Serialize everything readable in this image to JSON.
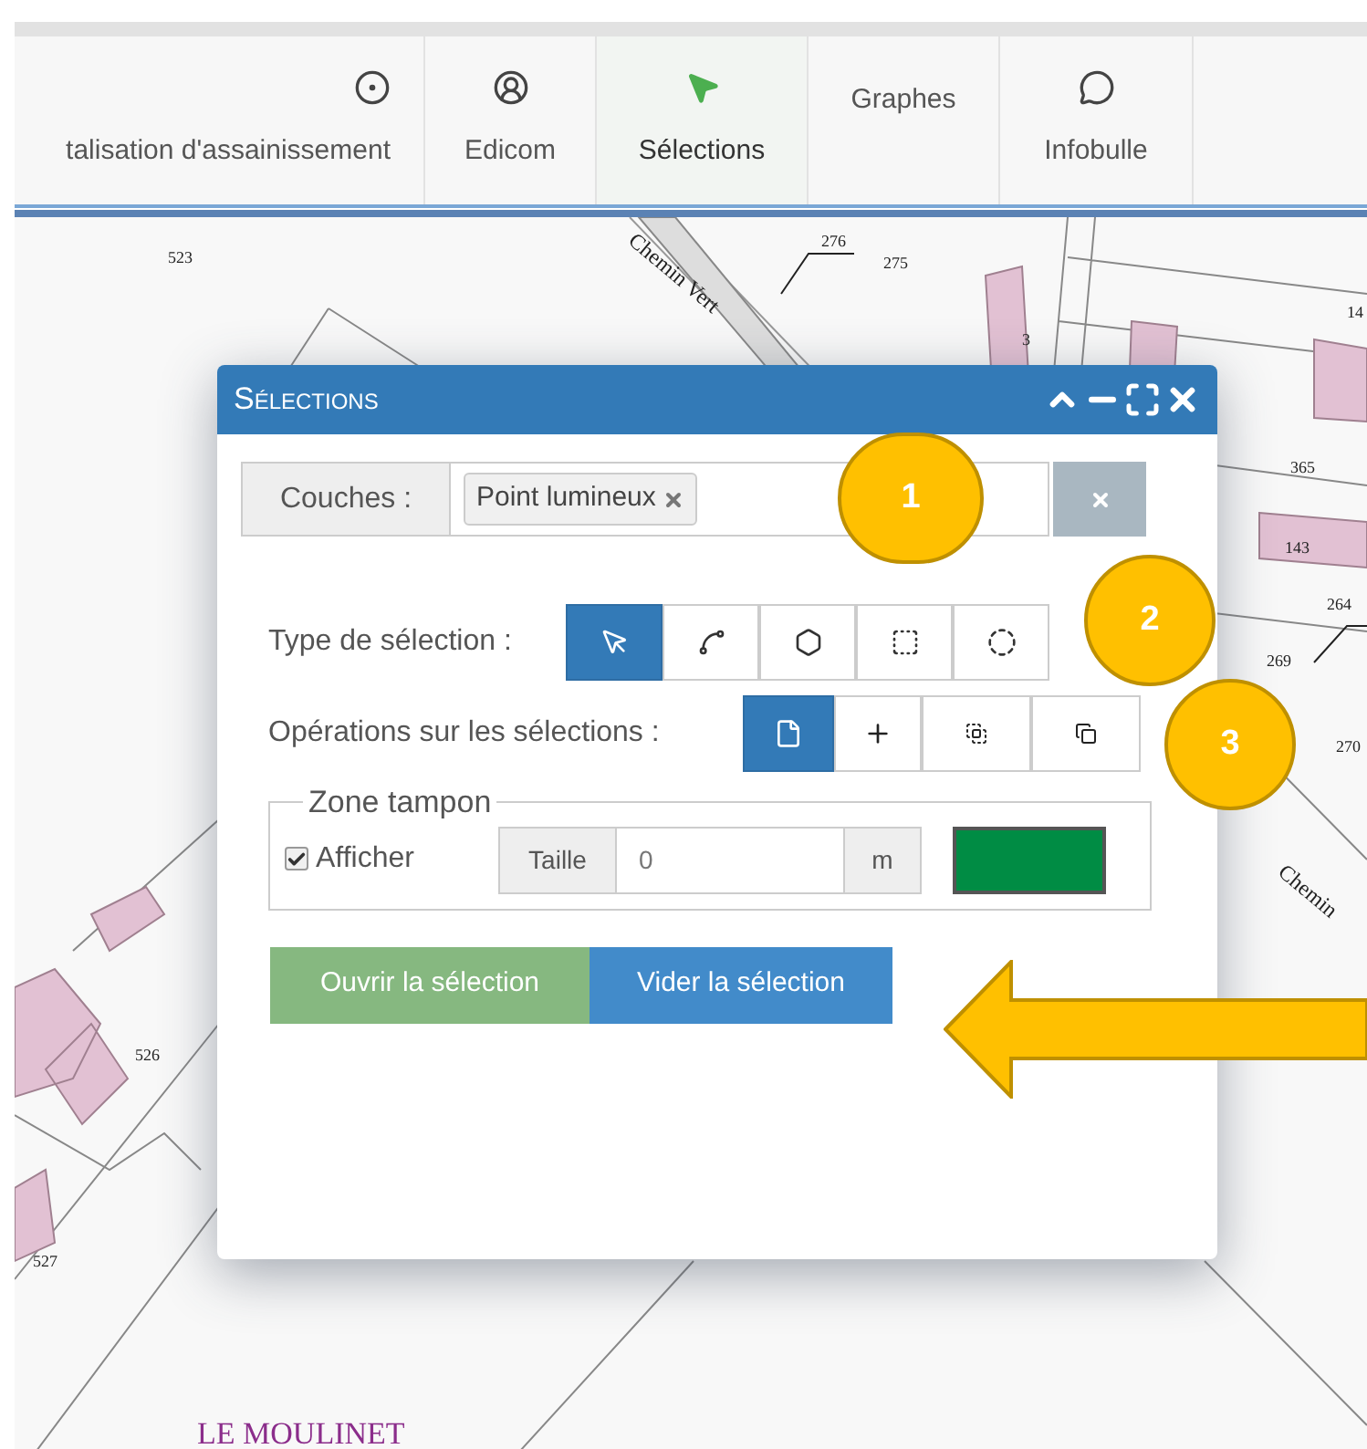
{
  "toolbar": {
    "items": [
      {
        "label": "talisation d'assainissement",
        "kind": "target",
        "selected": false
      },
      {
        "label": "Edicom",
        "kind": "user",
        "selected": false
      },
      {
        "label": "Sélections",
        "kind": "pointer",
        "selected": true
      },
      {
        "label": "Graphes",
        "kind": "text",
        "selected": false
      },
      {
        "label": "Infobulle",
        "kind": "speech",
        "selected": false
      }
    ]
  },
  "map": {
    "labels": [
      "523",
      "275",
      "276",
      "Chemin Vert",
      "14",
      "3",
      "365",
      "143",
      "264",
      "269",
      "270",
      "Chemin",
      "526",
      "527",
      "LE MOULINET"
    ]
  },
  "dialog": {
    "title": "Sélections",
    "layers": {
      "label": "Couches :",
      "tags": [
        {
          "label": "Point lumineux"
        }
      ]
    },
    "selection_type": {
      "label": "Type de sélection :",
      "tools": [
        {
          "kind": "point",
          "selected": true
        },
        {
          "kind": "line",
          "selected": false
        },
        {
          "kind": "polygon",
          "selected": false
        },
        {
          "kind": "rectangle",
          "selected": false
        },
        {
          "kind": "circle",
          "selected": false
        }
      ]
    },
    "operations": {
      "label": "Opérations sur les sélections :",
      "tools": [
        {
          "kind": "new",
          "selected": true
        },
        {
          "kind": "add",
          "selected": false
        },
        {
          "kind": "intersect",
          "selected": false
        },
        {
          "kind": "subtract",
          "selected": false
        }
      ]
    },
    "buffer": {
      "legend": "Zone tampon",
      "show": {
        "label": "Afficher",
        "checked": true
      },
      "size_label": "Taille",
      "size_value": "0",
      "unit": "m",
      "color": "#008c44"
    },
    "buttons": [
      {
        "label": "Ouvrir la sélection",
        "kind": "open"
      },
      {
        "label": "Vider la sélection",
        "kind": "clear"
      }
    ]
  },
  "callouts": [
    "1",
    "2",
    "3"
  ]
}
